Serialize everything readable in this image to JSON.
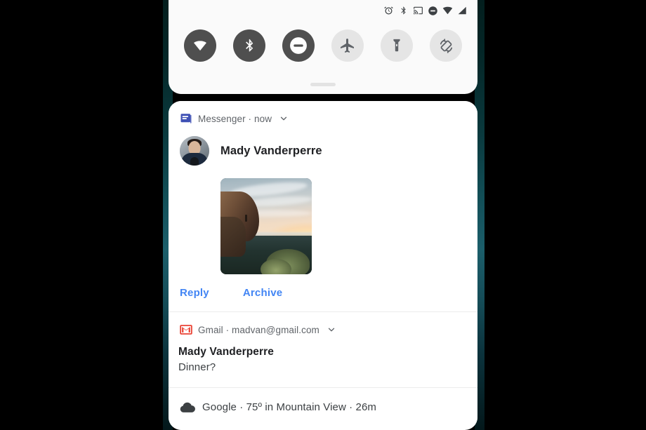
{
  "status_bar": {
    "icons": [
      {
        "name": "alarm-icon",
        "label": "Alarm set"
      },
      {
        "name": "bluetooth-icon",
        "label": "Bluetooth on"
      },
      {
        "name": "cast-icon",
        "label": "Cast"
      },
      {
        "name": "do-not-disturb-icon",
        "label": "Do not disturb"
      },
      {
        "name": "wifi-icon",
        "label": "Wi-Fi full signal"
      },
      {
        "name": "cell-signal-icon",
        "label": "Cellular signal"
      }
    ]
  },
  "quick_settings": {
    "tiles": [
      {
        "name": "wifi-tile",
        "label": "Wi-Fi",
        "state": "on"
      },
      {
        "name": "bluetooth-tile",
        "label": "Bluetooth",
        "state": "on"
      },
      {
        "name": "do-not-disturb-tile",
        "label": "Do Not Disturb",
        "state": "on"
      },
      {
        "name": "airplane-mode-tile",
        "label": "Airplane mode",
        "state": "off"
      },
      {
        "name": "flashlight-tile",
        "label": "Flashlight",
        "state": "off"
      },
      {
        "name": "auto-rotate-tile",
        "label": "Auto-rotate",
        "state": "off"
      }
    ],
    "colors": {
      "tile_on_bg": "#4f4f4f",
      "tile_off_bg": "#e5e5e5",
      "panel_bg": "#fafafa"
    }
  },
  "notifications": [
    {
      "id": "messenger",
      "app_name": "Messenger",
      "separator": "·",
      "timestamp": "now",
      "header_text": "Messenger · now",
      "sender": "Mady Vanderperre",
      "has_image_attachment": true,
      "attachment_alt": "Sunset landscape photo from a cliff overlook",
      "actions": [
        {
          "name": "reply-action",
          "label": "Reply"
        },
        {
          "name": "archive-action",
          "label": "Archive"
        }
      ],
      "action_color": "#4285f4"
    },
    {
      "id": "gmail",
      "app_name": "Gmail",
      "separator": "·",
      "account": "madvan@gmail.com",
      "header_text": "Gmail · madvan@gmail.com",
      "sender": "Mady Vanderperre",
      "subject": "Dinner?",
      "brand_color": "#ea4335"
    },
    {
      "id": "google-weather",
      "app_name": "Google",
      "separator": "·",
      "temperature": "75º",
      "location": "Mountain View",
      "timestamp": "26m",
      "summary_text": "Google · 75º in Mountain View · 26m"
    }
  ]
}
